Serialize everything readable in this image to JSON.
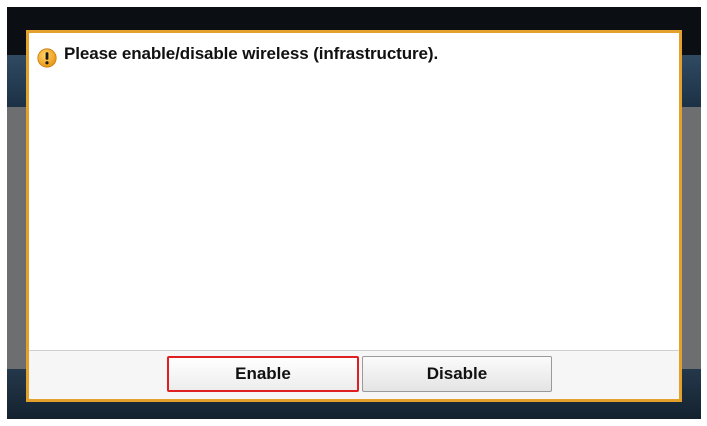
{
  "dialog": {
    "message": "Please enable/disable wireless (infrastructure).",
    "icon": "warning-icon"
  },
  "buttons": {
    "enable_label": "Enable",
    "disable_label": "Disable"
  },
  "colors": {
    "dialog_border": "#e3a12c",
    "focus_outline": "#e02020",
    "warning_icon": "#f2a81d"
  }
}
